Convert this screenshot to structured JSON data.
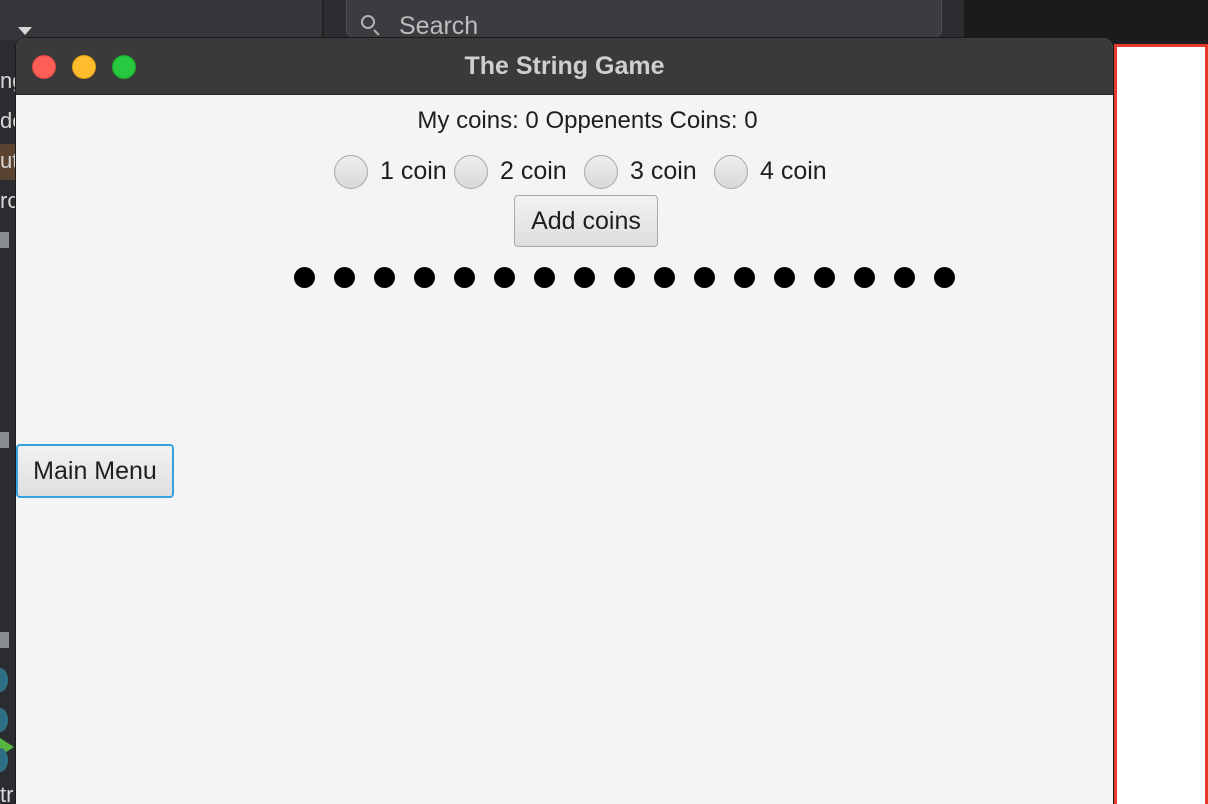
{
  "background": {
    "search_placeholder": "Search",
    "left_strip_fragments": [
      "ng",
      "de",
      "ut",
      "rc",
      "tr"
    ]
  },
  "window": {
    "title": "The String Game"
  },
  "score": {
    "text": "My coins: 0 Oppenents Coins: 0"
  },
  "coin_options": [
    {
      "label": "1 coin",
      "selected": false
    },
    {
      "label": "2 coin",
      "selected": false
    },
    {
      "label": "3 coin",
      "selected": false
    },
    {
      "label": "4 coin",
      "selected": false
    }
  ],
  "actions": {
    "add_coins_label": "Add coins",
    "main_menu_label": "Main Menu"
  },
  "string": {
    "remaining_count": 17
  },
  "colors": {
    "close": "#fe5f57",
    "minimize": "#febc2e",
    "maximize": "#28c840",
    "focus_ring": "#35a2e0",
    "panel_border": "#e63a2e"
  }
}
